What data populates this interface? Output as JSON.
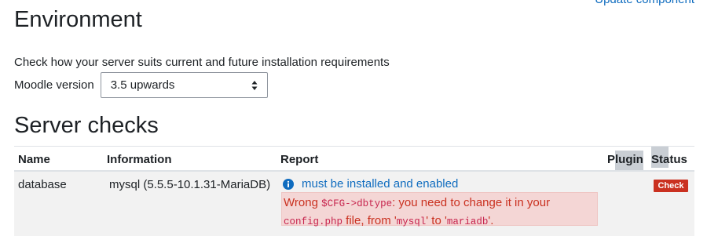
{
  "header": {
    "update_link": "Update component",
    "title": "Environment"
  },
  "intro_text": "Check how your server suits current and future installation requirements",
  "version": {
    "label": "Moodle version",
    "selected": "3.5 upwards"
  },
  "server_checks": {
    "title": "Server checks",
    "columns": {
      "name": "Name",
      "information": "Information",
      "report": "Report",
      "plugin": "Plugin",
      "status": "Status"
    },
    "rows": [
      {
        "name": "database",
        "information": "mysql (5.5.5-10.1.31-MariaDB)",
        "report_link": "must be installed and enabled",
        "alert": {
          "t1": "Wrong ",
          "c1": "$CFG->dbtype",
          "t2": ": you need to change it in your",
          "c2": "config.php",
          "t3": " file, from '",
          "c3": "mysql",
          "t4": "' to '",
          "c4": "mariadb",
          "t5": "'."
        },
        "plugin": "",
        "status": "Check"
      }
    ]
  },
  "colors": {
    "link": "#0f6cbf",
    "danger": "#ca3120",
    "alert_bg": "#f4d6d5",
    "code": "#c7254e",
    "row_bg": "#f2f2f2"
  }
}
